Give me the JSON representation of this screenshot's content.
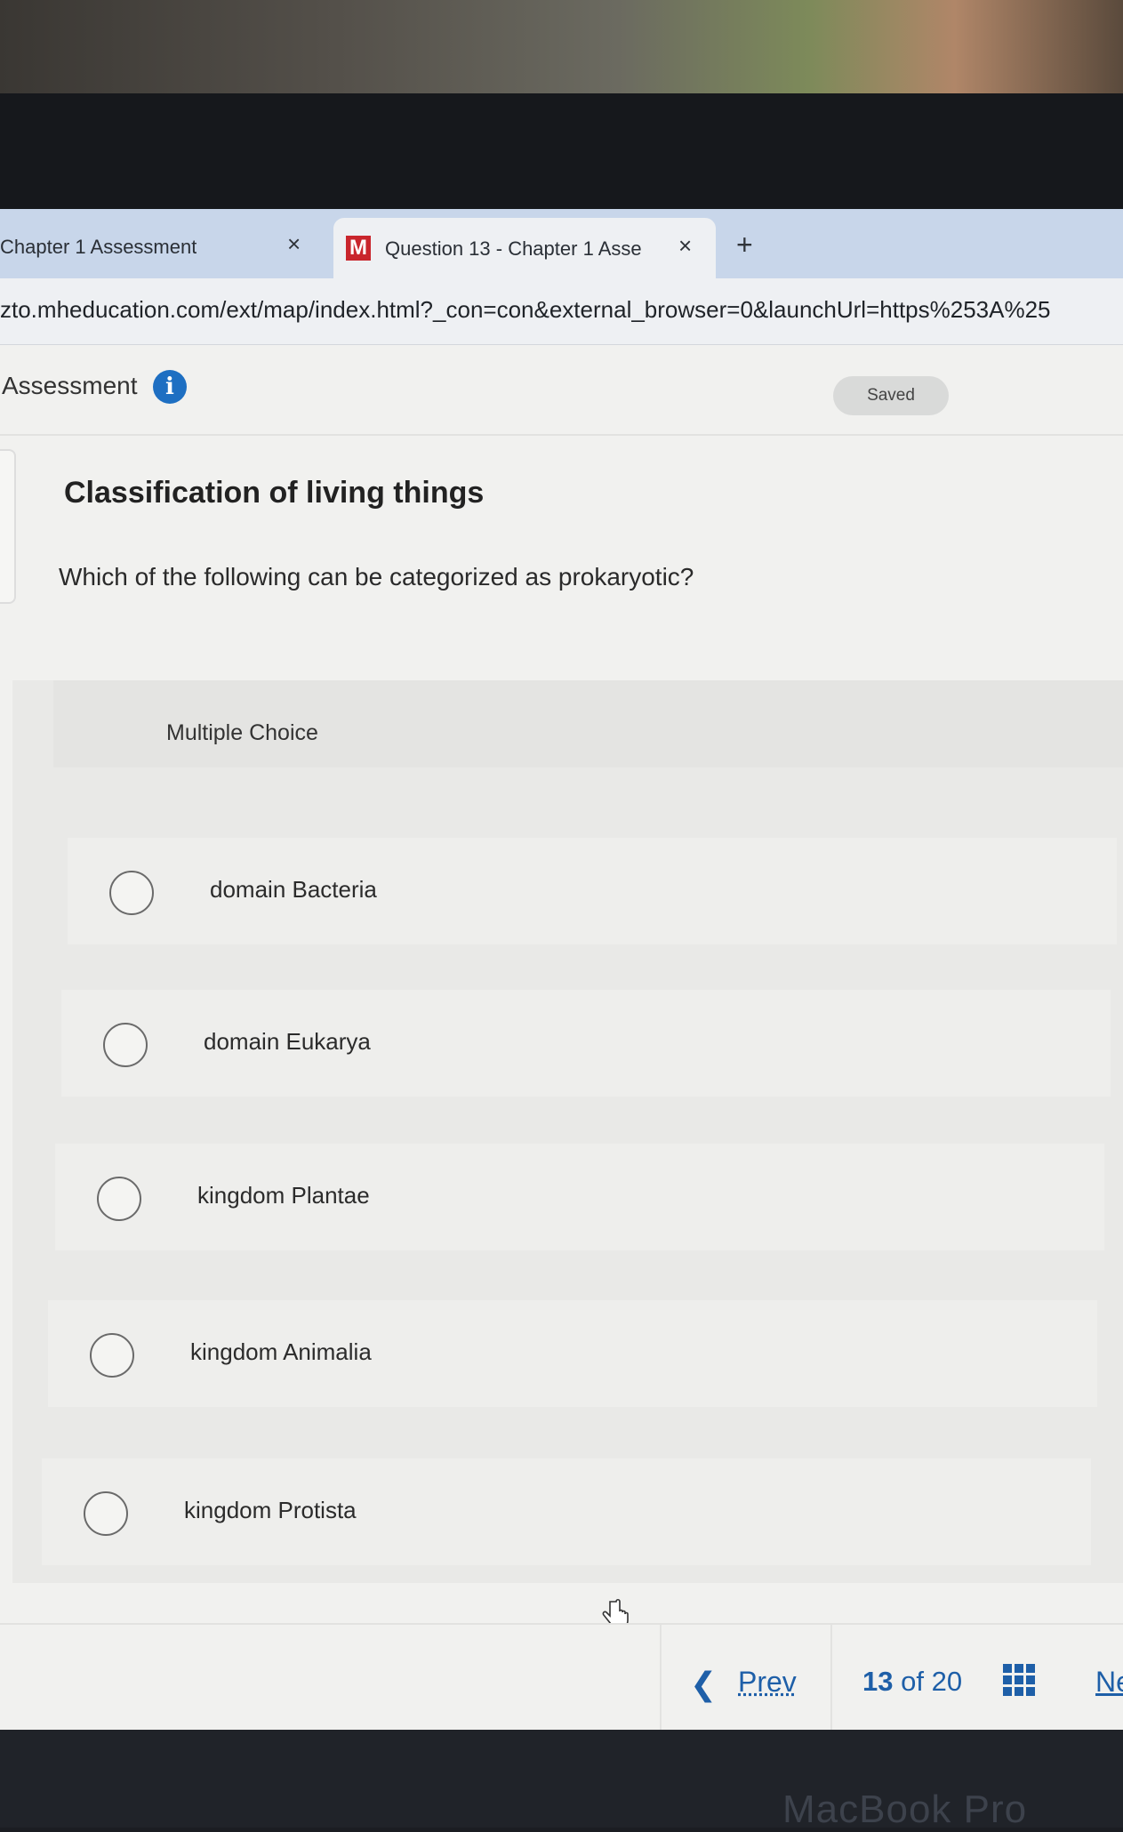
{
  "browser": {
    "tabs": [
      {
        "label": "Chapter 1 Assessment",
        "close": "×"
      },
      {
        "label": "Question 13 - Chapter 1 Asse",
        "close": "×",
        "logo": "M"
      }
    ],
    "new_tab": "+",
    "url": "zto.mheducation.com/ext/map/index.html?_con=con&external_browser=0&launchUrl=https%253A%25"
  },
  "header": {
    "title": "Assessment",
    "info_icon": "i",
    "status": "Saved"
  },
  "question": {
    "heading": "Classification of living things",
    "text": "Which of the following can be categorized as prokaryotic?",
    "type_label": "Multiple Choice",
    "choices": [
      {
        "label": "domain Bacteria"
      },
      {
        "label": "domain Eukarya"
      },
      {
        "label": "kingdom Plantae"
      },
      {
        "label": "kingdom Animalia"
      },
      {
        "label": "kingdom Protista"
      }
    ]
  },
  "navigation": {
    "prev_label": "Prev",
    "current": "13",
    "of_label": "of",
    "total": "20",
    "next_label": "Next"
  },
  "device": {
    "label": "MacBook Pro"
  },
  "colors": {
    "accent": "#1e5fa8",
    "info": "#1e6fc2",
    "brand": "#c9252c"
  }
}
